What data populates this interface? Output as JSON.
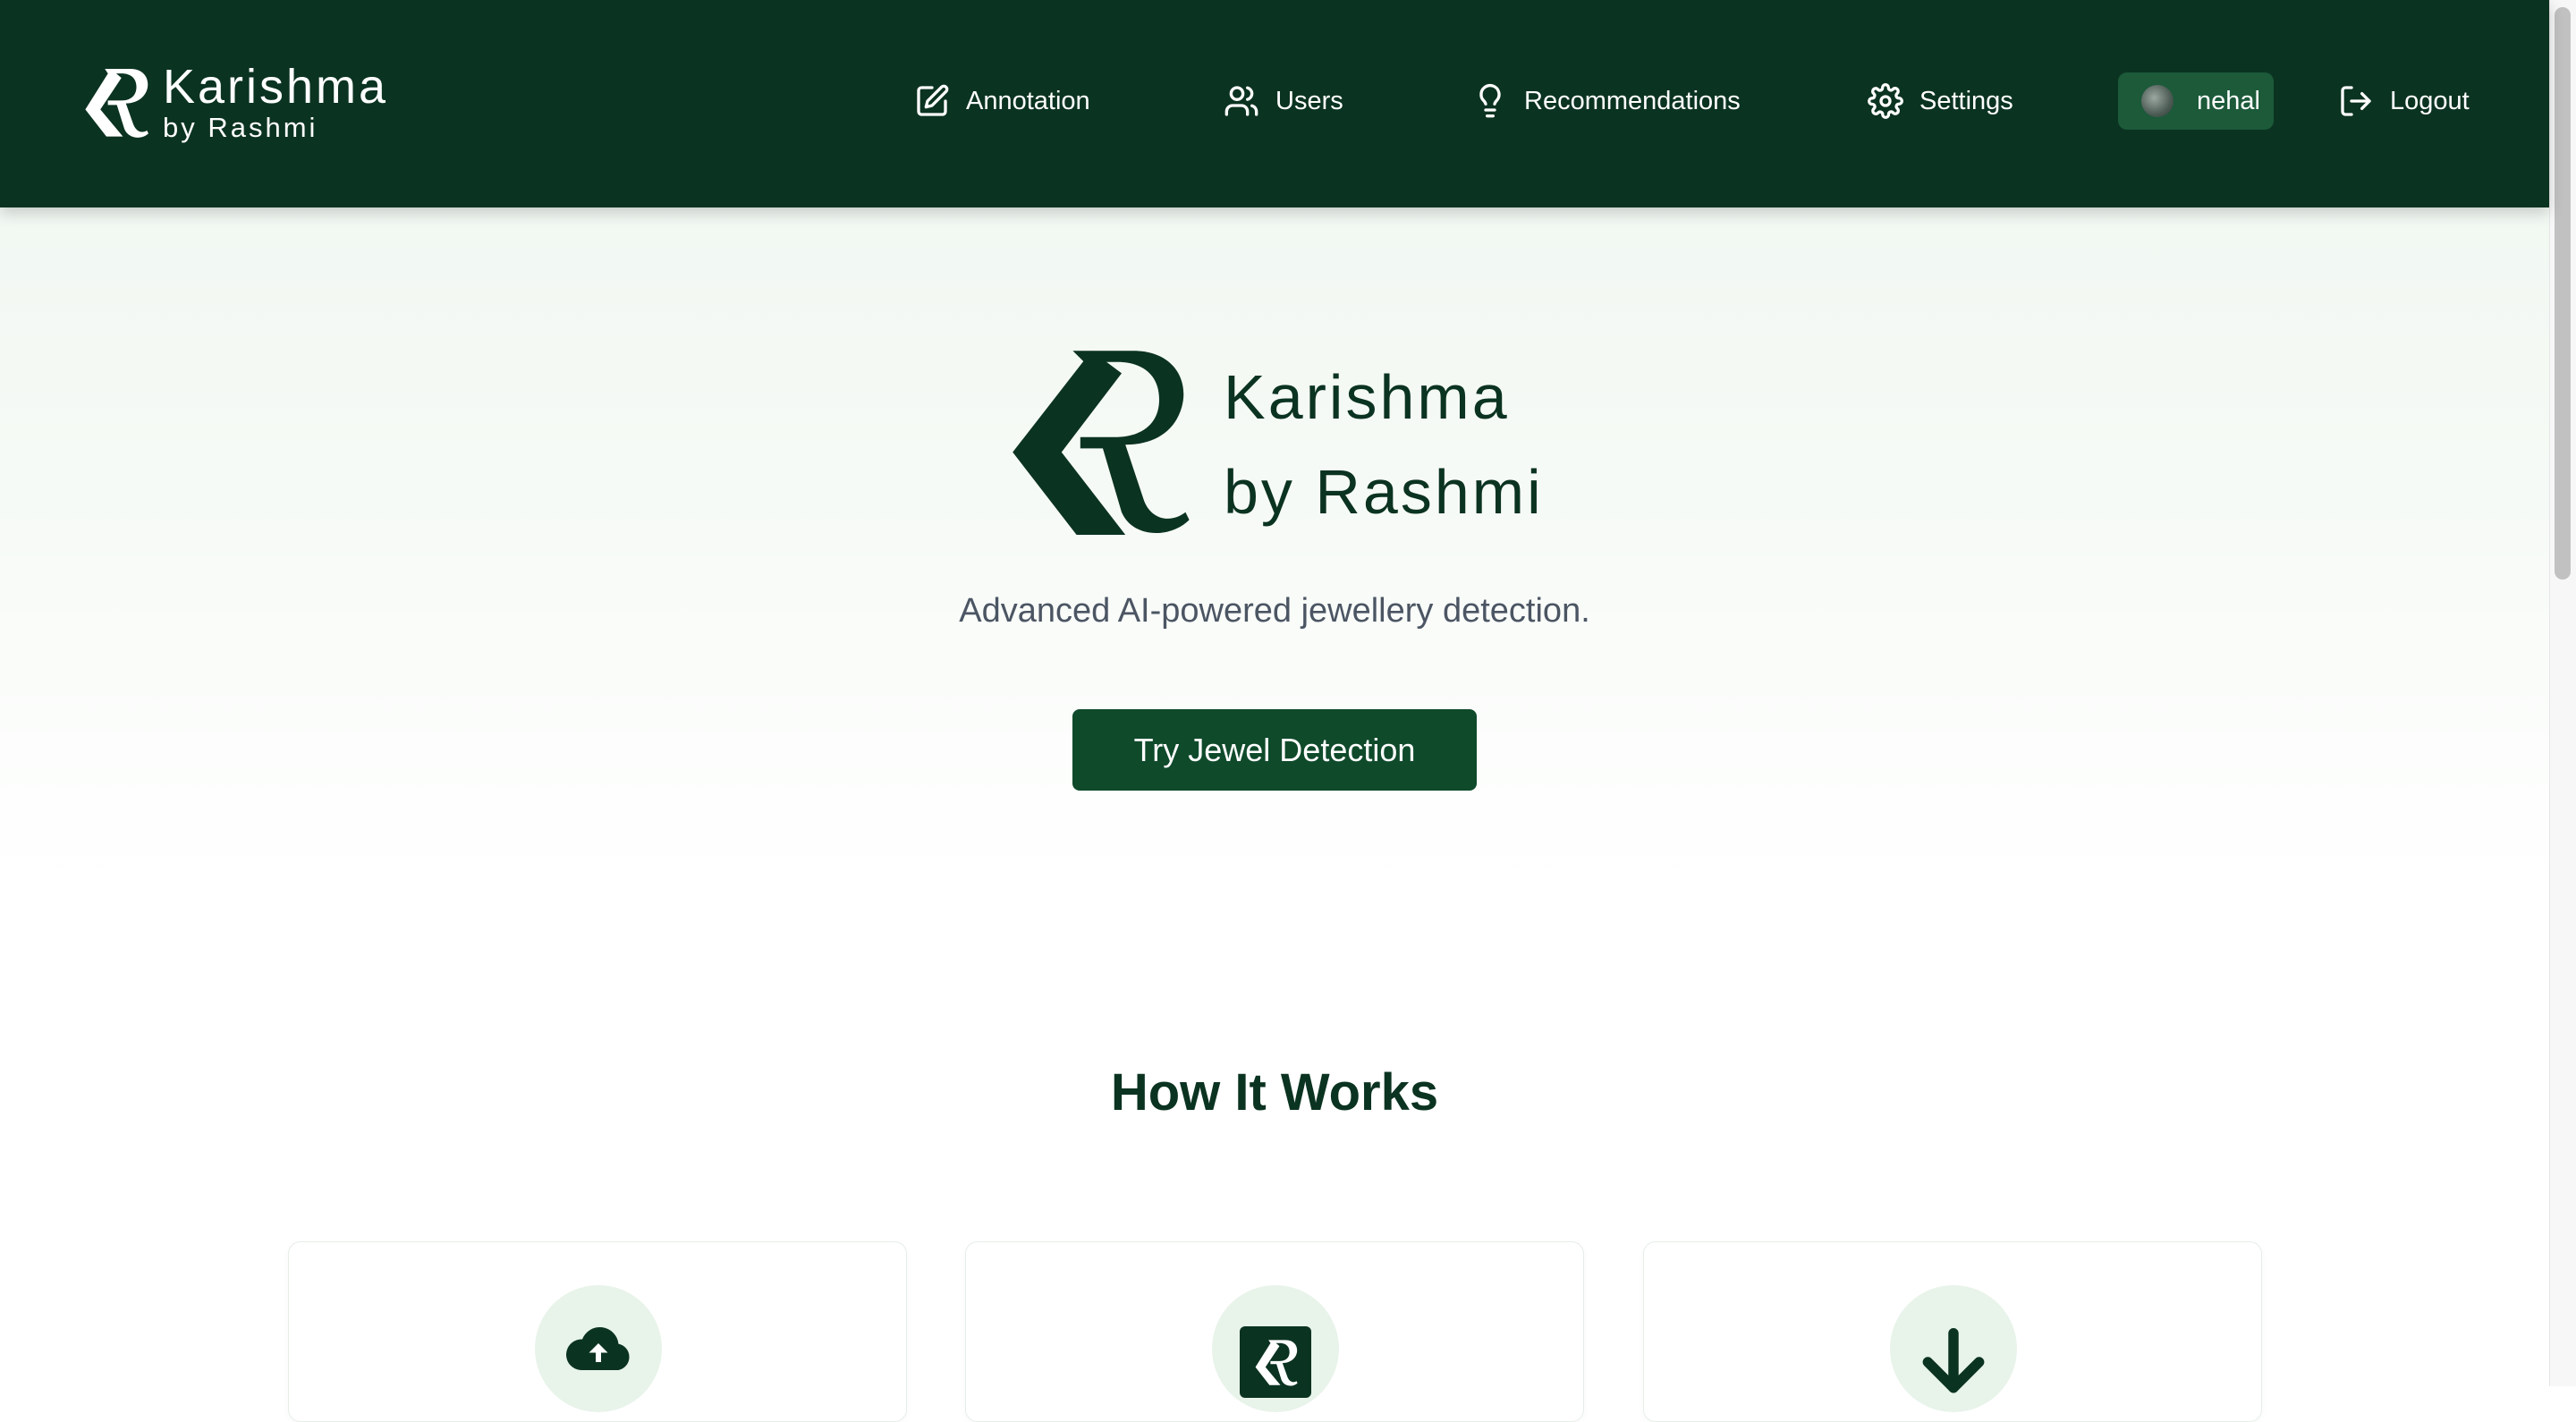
{
  "brand": {
    "name": "Karishma",
    "sub": "by Rashmi"
  },
  "nav": {
    "annotation": "Annotation",
    "users": "Users",
    "recommendations": "Recommendations",
    "settings": "Settings",
    "user": "nehal",
    "logout": "Logout"
  },
  "hero": {
    "name": "Karishma",
    "sub": "by Rashmi",
    "tagline": "Advanced AI-powered jewellery detection.",
    "cta": "Try Jewel Detection"
  },
  "how": {
    "title": "How It Works"
  },
  "cards": [
    {
      "icon": "cloud-upload-icon"
    },
    {
      "icon": "kr-logo-icon"
    },
    {
      "icon": "arrow-down-icon"
    }
  ],
  "colors": {
    "primary": "#0b3321",
    "button": "#0f4a2b",
    "accent_bg": "#e8f3ea"
  }
}
